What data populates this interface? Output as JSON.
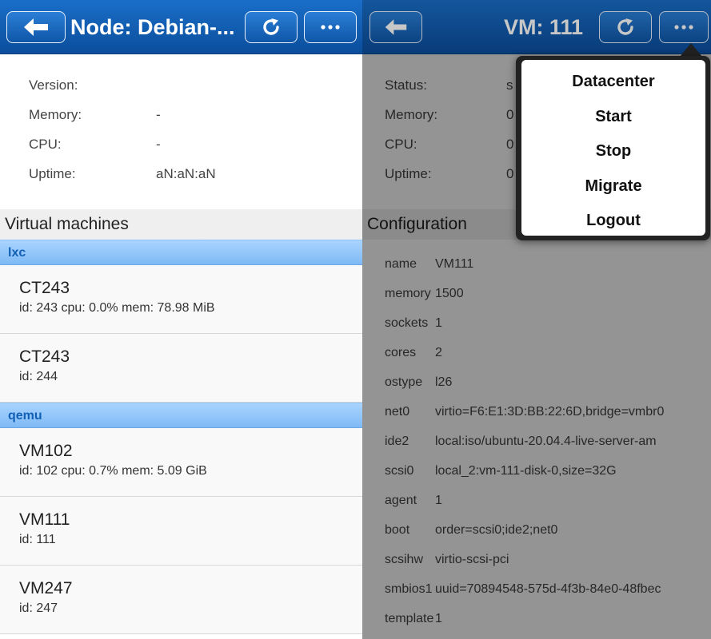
{
  "left": {
    "title": "Node: Debian-...",
    "info": [
      {
        "label": "Version:",
        "value": ""
      },
      {
        "label": "Memory:",
        "value": "-"
      },
      {
        "label": "CPU:",
        "value": "-"
      },
      {
        "label": "Uptime:",
        "value": "aN:aN:aN"
      }
    ],
    "section_title": "Virtual machines",
    "groups": [
      {
        "name": "lxc",
        "items": [
          {
            "name": "CT243",
            "info": "id: 243 cpu: 0.0% mem: 78.98 MiB"
          },
          {
            "name": "CT243",
            "info": "id: 244"
          }
        ]
      },
      {
        "name": "qemu",
        "items": [
          {
            "name": "VM102",
            "info": "id: 102 cpu: 0.7% mem: 5.09 GiB"
          },
          {
            "name": "VM111",
            "info": "id: 111"
          },
          {
            "name": "VM247",
            "info": "id: 247"
          }
        ]
      }
    ]
  },
  "right": {
    "title": "VM: 111",
    "info": [
      {
        "label": "Status:",
        "value": "s"
      },
      {
        "label": "Memory:",
        "value": "0"
      },
      {
        "label": "CPU:",
        "value": "0"
      },
      {
        "label": "Uptime:",
        "value": "0"
      }
    ],
    "section_title": "Configuration",
    "config": [
      {
        "key": "name",
        "value": "VM111"
      },
      {
        "key": "memory",
        "value": "1500"
      },
      {
        "key": "sockets",
        "value": "1"
      },
      {
        "key": "cores",
        "value": "2"
      },
      {
        "key": "ostype",
        "value": "l26"
      },
      {
        "key": "net0",
        "value": "virtio=F6:E1:3D:BB:22:6D,bridge=vmbr0"
      },
      {
        "key": "ide2",
        "value": "local:iso/ubuntu-20.04.4-live-server-am"
      },
      {
        "key": "scsi0",
        "value": "local_2:vm-111-disk-0,size=32G"
      },
      {
        "key": "agent",
        "value": "1"
      },
      {
        "key": "boot",
        "value": "order=scsi0;ide2;net0"
      },
      {
        "key": "scsihw",
        "value": "virtio-scsi-pci"
      },
      {
        "key": "smbios1",
        "value": "uuid=70894548-575d-4f3b-84e0-48fbec"
      },
      {
        "key": "template",
        "value": "1"
      }
    ]
  },
  "menu": {
    "items": [
      "Datacenter",
      "Start",
      "Stop",
      "Migrate",
      "Logout"
    ]
  },
  "icons": {
    "back": "arrow-left-icon",
    "refresh": "refresh-icon",
    "more": "ellipsis-icon"
  }
}
